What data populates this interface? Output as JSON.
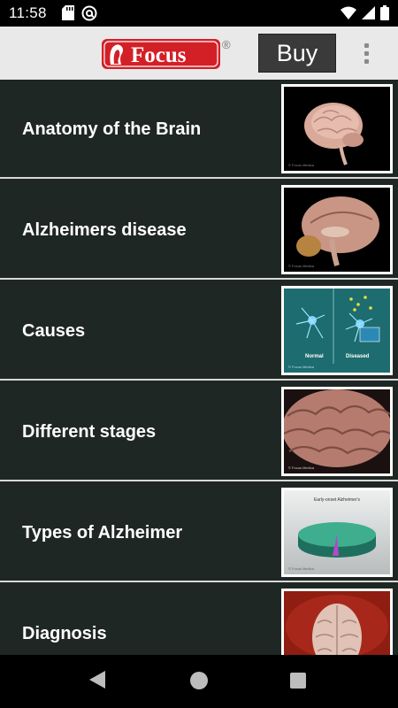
{
  "status_bar": {
    "time": "11:58",
    "left_icons": [
      "sd-card-icon",
      "at-sign-icon"
    ],
    "right_icons": [
      "wifi-icon",
      "signal-icon",
      "battery-icon"
    ]
  },
  "app_bar": {
    "logo_text": "Focus",
    "registered_mark": "®",
    "buy_label": "Buy",
    "menu_icon": "overflow-menu-icon"
  },
  "topics": [
    {
      "label": "Anatomy of the Brain",
      "thumbnail": "brain-side-view",
      "credit": "© Focus Medica"
    },
    {
      "label": "Alzheimers disease",
      "thumbnail": "brain-cross-section",
      "credit": "© Focus Medica"
    },
    {
      "label": "Causes",
      "thumbnail": "neuron-comparison",
      "caption_left": "Normal",
      "caption_right": "Diseased",
      "credit": "© Focus Medica"
    },
    {
      "label": "Different stages",
      "thumbnail": "brain-closeup",
      "credit": "© Focus Medica"
    },
    {
      "label": "Types of Alzheimer",
      "thumbnail": "pie-chart",
      "chart_title": "Early-onset Alzheimer's",
      "credit": "© Focus Medica"
    },
    {
      "label": "Diagnosis",
      "thumbnail": "brain-top-view"
    }
  ],
  "colors": {
    "list_background": "#1f2724",
    "app_bar_background": "#e9e9e9",
    "buy_button": "#3a3a3a",
    "logo_red": "#d32027"
  }
}
